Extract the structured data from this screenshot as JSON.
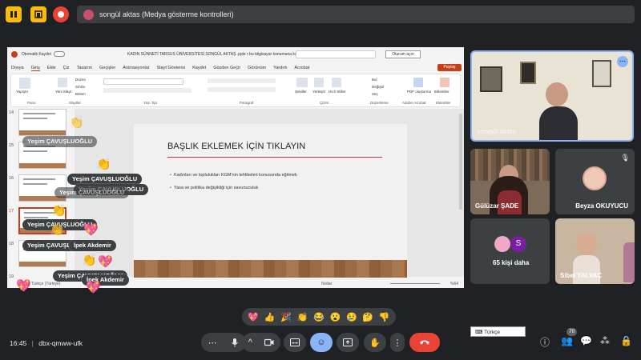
{
  "topbar": {
    "presenting_text": "songül aktas (Medya gösterme kontrolleri)"
  },
  "powerpoint": {
    "autosave_label": "Otomatik Kaydet",
    "file_title": "KADIN SÜNNETİ TARSUS ÜNİVERSİTESİ SONGÜL AKTAŞ .pptx  •  bu bilgisayar konumuna kaydedildi",
    "signin_label": "Oturum açın",
    "share_label": "Paylaş",
    "menu": [
      "Dosya",
      "Giriş",
      "Ekle",
      "Çiz",
      "Tasarım",
      "Geçişler",
      "Animasyonlar",
      "Slayt Gösterisi",
      "Kaydet",
      "Gözden Geçir",
      "Görünüm",
      "Yardım",
      "Acrobat"
    ],
    "ribbon_groups": [
      "Pano",
      "Slaytlar",
      "Yazı Tipi",
      "Paragraf",
      "Çizim",
      "Düzenleme",
      "Adobe Acrobat",
      "Eklentiler"
    ],
    "ribbon_buttons": {
      "paste": "Yapıştır",
      "new_slide": "Yeni Slayt",
      "layout": "Düzen",
      "reset": "Sıfırla",
      "section": "Bölüm",
      "shapes": "Şekiller",
      "arrange": "Yerleştir",
      "quick_styles": "Hızlı Stiller",
      "find": "Bul",
      "replace": "Değiştir",
      "select": "Seç",
      "pdf": "PDF oluşturma",
      "addins": "Eklentiler"
    },
    "thumb_numbers": [
      "14",
      "15",
      "16",
      "17",
      "18",
      "19"
    ],
    "slide": {
      "title": "BAŞLIK EKLEMEK İÇİN TIKLAYIN",
      "bullets": [
        "Kadınları ve toplulukları KGM'nin tehlikeleri konusunda eğitmek",
        "Yasa ve politika değişikliği için savunuculuk"
      ]
    },
    "status": {
      "left": "Türkçe (Türkiye)",
      "notes": "Notlar",
      "zoom": "%64"
    }
  },
  "reactions": [
    {
      "name": "Yeşim ÇAVUŞLUOĞLU"
    },
    {
      "name": "Yeşim ÇAVUŞLUOĞLU"
    },
    {
      "name": "Yeşim ÇAVUŞLUOĞLU"
    },
    {
      "name": "Yeşim ÇAVUŞLUOĞLU"
    },
    {
      "name": "Yeşim ÇAVUŞLUOĞLU"
    },
    {
      "name": "Yeşim ÇAVUŞLU"
    },
    {
      "name": "İpek Akdemir"
    },
    {
      "name": "Yeşim ÇAVUŞLUOĞLU"
    },
    {
      "name": "İpek Akdemir"
    }
  ],
  "participants": {
    "main": "songül aktas",
    "tile2": "Gülüzar ŞADE",
    "tile3": "Beyza OKUYUCU",
    "tile4": "65 kişi daha",
    "tile4_avatar": "S",
    "tile5": "Sibel YALVAÇ"
  },
  "language_box": "Türkçe",
  "reaction_bar": [
    "💖",
    "👍",
    "🎉",
    "👏",
    "😂",
    "😮",
    "😢",
    "🤔",
    "👎"
  ],
  "bottom": {
    "time": "16:45",
    "meeting_code": "dbx-qmww-ufk",
    "participant_count": "70"
  }
}
